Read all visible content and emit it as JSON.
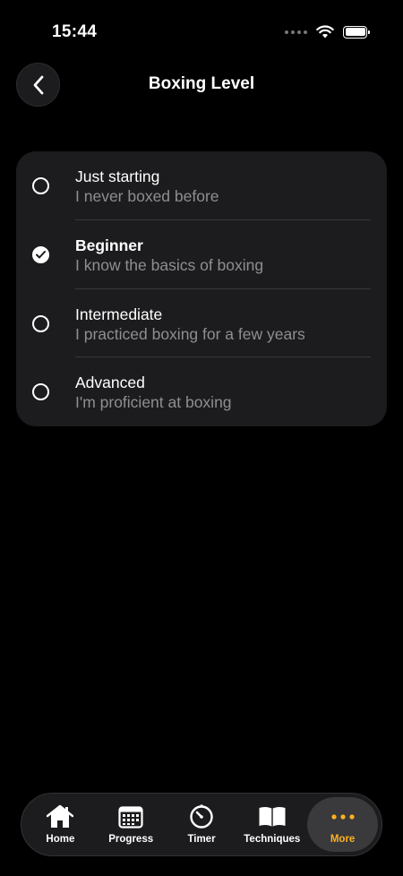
{
  "status_bar": {
    "time": "15:44"
  },
  "header": {
    "title": "Boxing Level"
  },
  "options": [
    {
      "title": "Just starting",
      "subtitle": "I never boxed before",
      "selected": false
    },
    {
      "title": "Beginner",
      "subtitle": "I know the basics of boxing",
      "selected": true
    },
    {
      "title": "Intermediate",
      "subtitle": "I practiced boxing for a few years",
      "selected": false
    },
    {
      "title": "Advanced",
      "subtitle": "I'm proficient at boxing",
      "selected": false
    }
  ],
  "tab_bar": {
    "tabs": [
      {
        "label": "Home",
        "icon": "home-icon"
      },
      {
        "label": "Progress",
        "icon": "calendar-icon"
      },
      {
        "label": "Timer",
        "icon": "timer-icon"
      },
      {
        "label": "Techniques",
        "icon": "book-icon"
      },
      {
        "label": "More",
        "icon": "more-dots-icon",
        "active": true
      }
    ]
  },
  "colors": {
    "background": "#000000",
    "card": "#1c1c1e",
    "secondary_text": "#8e8e93",
    "accent": "#ffb020"
  }
}
